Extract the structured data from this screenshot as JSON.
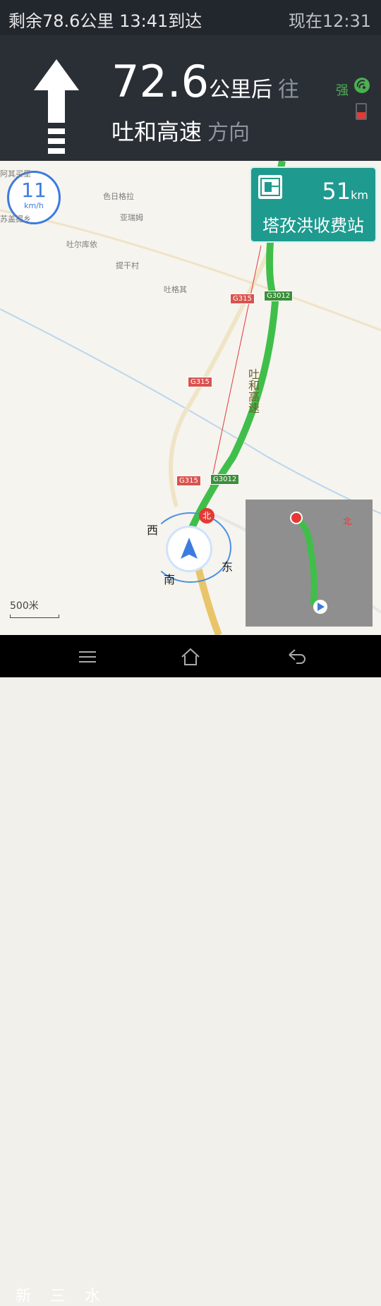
{
  "status": {
    "left_text": "剩余78.6公里  13:41到达",
    "right_text": "现在12:31"
  },
  "guide": {
    "distance": "72.6",
    "distance_unit": "公里后",
    "toward": "往",
    "road": "吐和高速",
    "direction_word": "方向",
    "signal_label": "强",
    "arrow_icon": "straight-arrow-icon"
  },
  "map": {
    "speed_value": "11",
    "speed_unit": "km/h",
    "toll": {
      "distance": "51",
      "unit": "km",
      "name": "塔孜洪收费站",
      "icon": "toll-booth-icon"
    },
    "places": [
      "阿其买里",
      "苏盖提乡",
      "色日格拉",
      "亚瑞姆",
      "吐尔库依",
      "提干村",
      "吐格其"
    ],
    "shields": {
      "g315_1": "G315",
      "g315_2": "G315",
      "g315_3": "G315",
      "g3012_1": "G3012",
      "g3012_2": "G3012"
    },
    "road_label": "吐和高速",
    "compass": {
      "west": "西",
      "south": "南",
      "east": "东",
      "north": "北"
    },
    "scale": "500米"
  },
  "nav": {
    "menu_icon": "menu-icon",
    "home_icon": "home-icon",
    "back_icon": "back-icon",
    "watermark": "新 三 水"
  },
  "colors": {
    "route": "#3fbf4a",
    "accent": "#3c7be0",
    "toll": "#1f9a8f",
    "north": "#e53935"
  }
}
